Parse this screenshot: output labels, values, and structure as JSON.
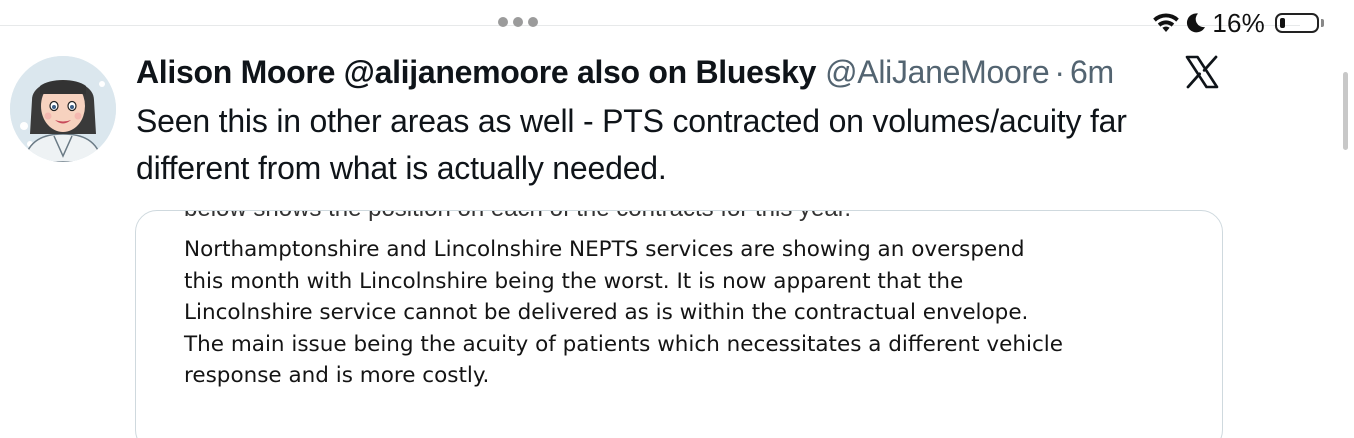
{
  "status_bar": {
    "battery_percent": "16%",
    "battery_level": 0.16,
    "icons": [
      "wifi-icon",
      "moon-icon",
      "battery-icon"
    ]
  },
  "tweet": {
    "author_name": "Alison Moore @alijanemoore also on Bluesky",
    "handle": "@AliJaneMoore",
    "separator": "·",
    "time": "6m",
    "platform_icon": "x-logo-icon",
    "text": "Seen this in other areas as well - PTS contracted on volumes/acuity far different from what is actually needed.",
    "media": {
      "cutoff_text": "below shows the position on each of the contracts for this year.",
      "lines": [
        "Northamptonshire and Lincolnshire NEPTS services are showing an overspend",
        "this month with Lincolnshire being the worst. It is now apparent that the",
        "Lincolnshire service cannot be delivered as is within the contractual envelope.",
        "The main issue being the acuity of patients which necessitates a different vehicle",
        "response and is more costly."
      ]
    }
  },
  "colors": {
    "text": "#0f1419",
    "secondary": "#536471",
    "border": "#cfd9de"
  }
}
